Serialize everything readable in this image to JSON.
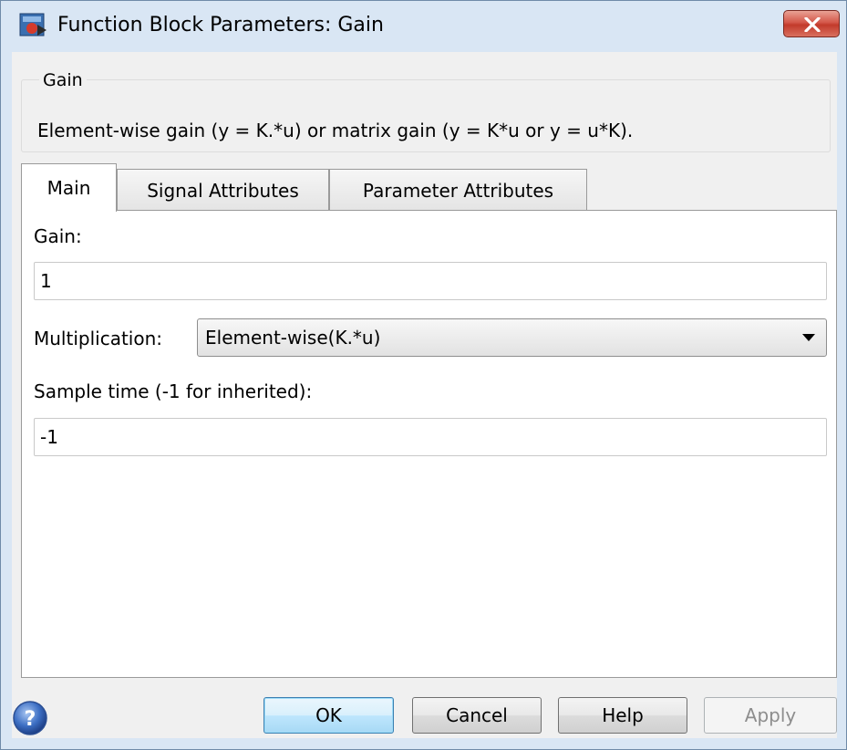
{
  "window": {
    "title": "Function Block Parameters: Gain"
  },
  "group": {
    "title": "Gain",
    "description": "Element-wise gain (y = K.*u) or matrix gain (y = K*u or y = u*K)."
  },
  "tabs": [
    {
      "label": "Main",
      "active": true
    },
    {
      "label": "Signal Attributes",
      "active": false
    },
    {
      "label": "Parameter Attributes",
      "active": false
    }
  ],
  "main": {
    "gain_label": "Gain:",
    "gain_value": "1",
    "multiplication_label": "Multiplication:",
    "multiplication_value": "Element-wise(K.*u)",
    "sample_time_label": "Sample time (-1 for inherited):",
    "sample_time_value": "-1"
  },
  "buttons": {
    "ok": "OK",
    "cancel": "Cancel",
    "help": "Help",
    "apply": "Apply",
    "apply_enabled": false
  },
  "icons": {
    "app": "simulink-block-icon",
    "close": "close-icon",
    "help": "help-icon",
    "dropdown": "chevron-down-icon"
  },
  "colors": {
    "window_frame": "#d9e6f4",
    "close_button": "#c23a2b",
    "ok_button_border": "#3c7fb1",
    "disabled_text": "#8d8d8d"
  }
}
